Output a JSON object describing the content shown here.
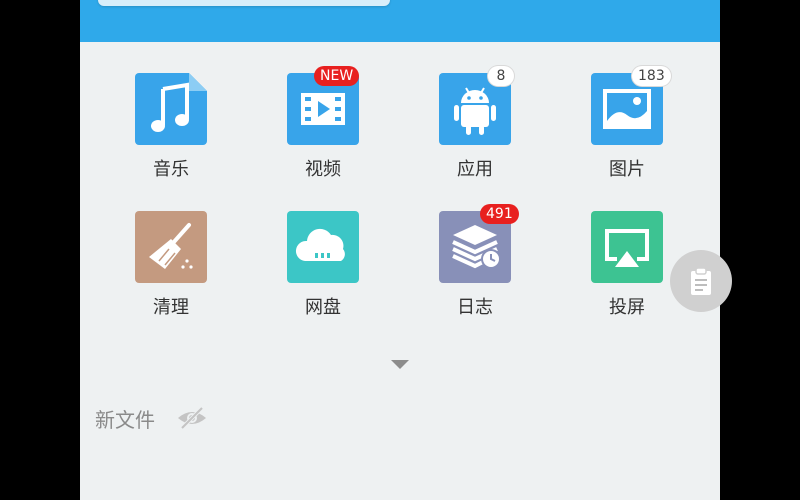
{
  "grid": {
    "items": [
      {
        "label": "音乐",
        "icon": "music-note-icon",
        "color": "#38a4ea",
        "badge": ""
      },
      {
        "label": "视频",
        "icon": "video-film-icon",
        "color": "#38a4ea",
        "badge": "NEW"
      },
      {
        "label": "应用",
        "icon": "android-icon",
        "color": "#38a4ea",
        "badge": "8"
      },
      {
        "label": "图片",
        "icon": "image-icon",
        "color": "#38a4ea",
        "badge": "183"
      },
      {
        "label": "清理",
        "icon": "broom-icon",
        "color": "#c49a80",
        "badge": ""
      },
      {
        "label": "网盘",
        "icon": "cloud-icon",
        "color": "#3cc6c6",
        "badge": ""
      },
      {
        "label": "日志",
        "icon": "log-stack-clock-icon",
        "color": "#8890b8",
        "badge": "491"
      },
      {
        "label": "投屏",
        "icon": "airplay-icon",
        "color": "#3dc392",
        "badge": ""
      }
    ]
  },
  "new_files": {
    "label": "新文件",
    "icon": "eye-hidden-icon"
  },
  "float_button": {
    "icon": "clipboard-icon"
  },
  "colors": {
    "header": "#2fa9ea",
    "background": "#eef1f2",
    "badge_red": "#e8201f"
  }
}
